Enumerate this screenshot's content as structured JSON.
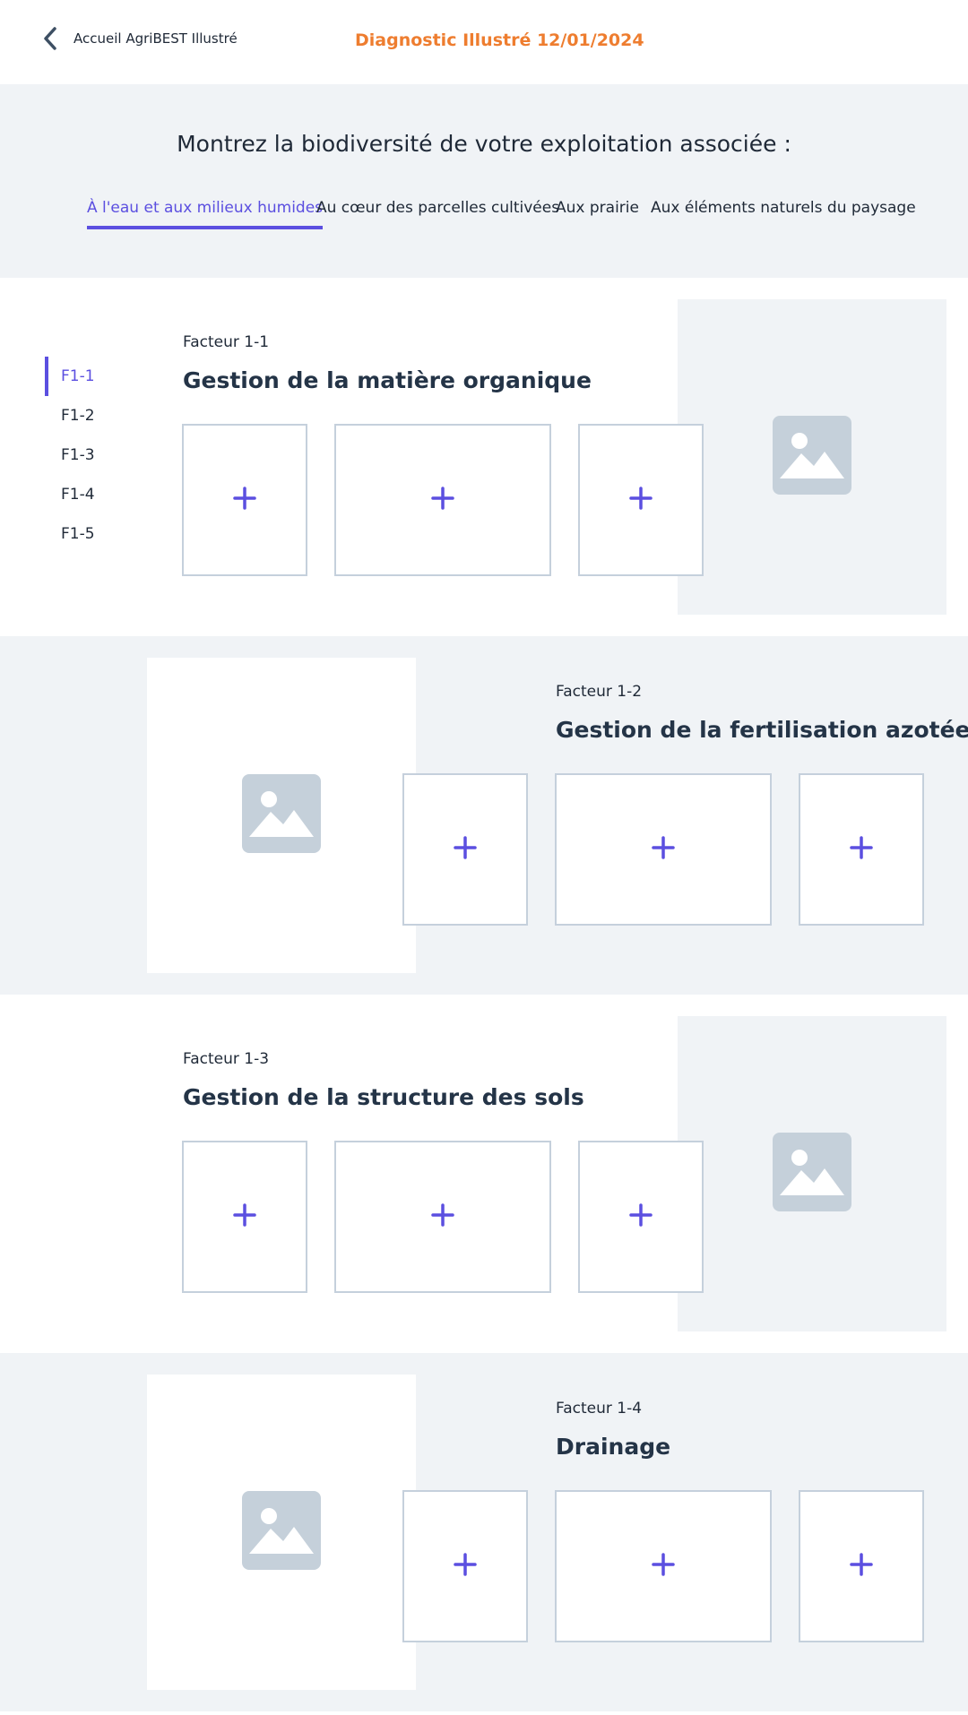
{
  "header": {
    "back_label": "Accueil AgriBEST Illustré",
    "title": "Diagnostic Illustré 12/01/2024"
  },
  "hero": {
    "title": "Montrez la biodiversité de votre exploitation associée :",
    "tabs": [
      {
        "label": "À l'eau et aux milieux humides",
        "active": true
      },
      {
        "label": "Au cœur des parcelles cultivées",
        "active": false
      },
      {
        "label": "Aux prairie",
        "active": false
      },
      {
        "label": "Aux éléments naturels du paysage",
        "active": false
      }
    ]
  },
  "nav": {
    "items": [
      {
        "label": "F1-1",
        "active": true
      },
      {
        "label": "F1-2",
        "active": false
      },
      {
        "label": "F1-3",
        "active": false
      },
      {
        "label": "F1-4",
        "active": false
      },
      {
        "label": "F1-5",
        "active": false
      }
    ]
  },
  "factors": [
    {
      "label": "Facteur 1-1",
      "title": "Gestion de la matière organique"
    },
    {
      "label": "Facteur 1-2",
      "title": "Gestion de la fertilisation azotée"
    },
    {
      "label": "Facteur 1-3",
      "title": "Gestion de la structure des sols"
    },
    {
      "label": "Facteur 1-4",
      "title": "Drainage"
    }
  ],
  "add_symbol": "+",
  "colors": {
    "accent": "#5b4fe0",
    "title_orange": "#ee7d2f",
    "panel_gray": "#f0f3f6",
    "placeholder_icon": "#c5d0da",
    "box_border": "#c5d0dc"
  }
}
